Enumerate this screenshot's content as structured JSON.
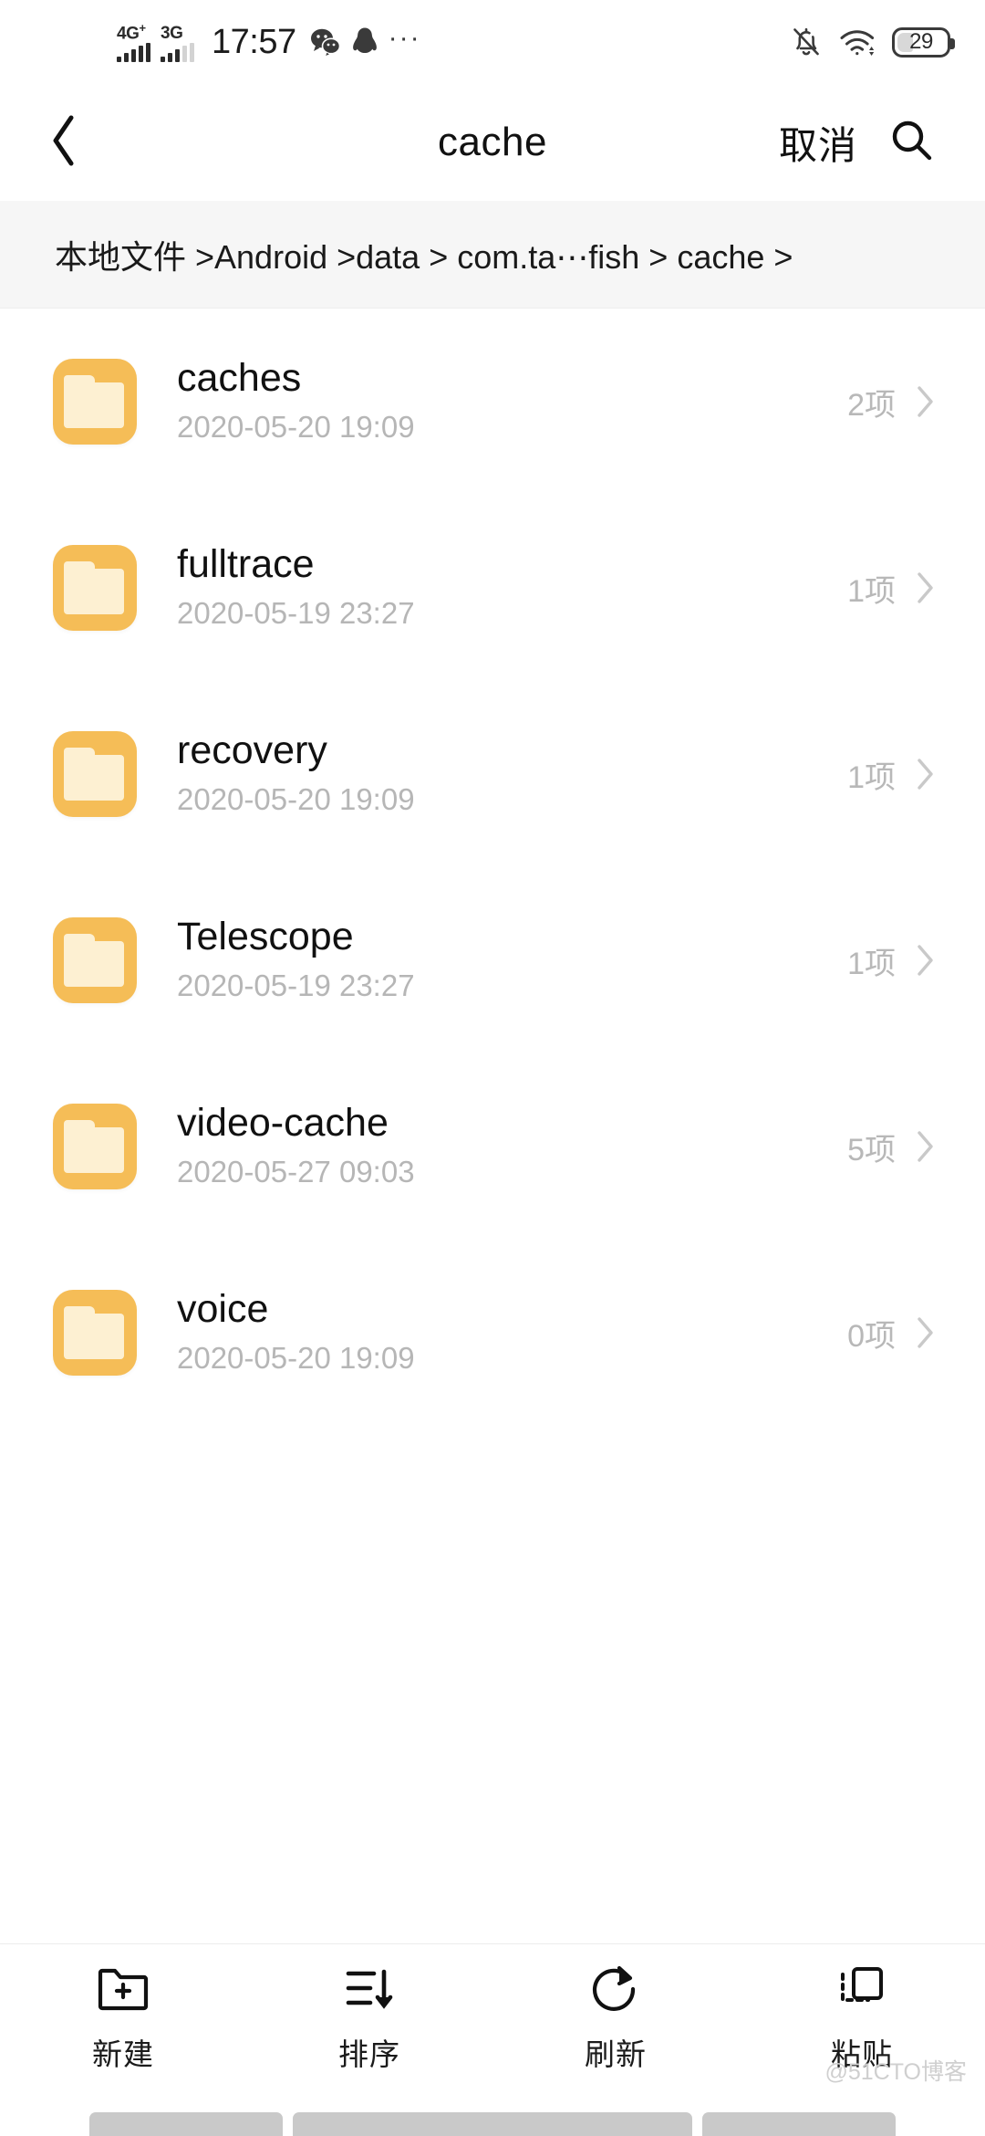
{
  "statusbar": {
    "network_primary": "4G",
    "network_primary_sup": "+",
    "network_secondary": "3G",
    "time": "17:57",
    "icons": [
      "wechat-icon",
      "qq-icon",
      "more-dots-icon",
      "bell-muted-icon",
      "wifi-icon"
    ],
    "battery_percent": "29"
  },
  "header": {
    "back": "back-chevron",
    "title": "cache",
    "cancel_label": "取消",
    "search": "search-icon"
  },
  "breadcrumb": {
    "text": "本地文件 >Android >data > com.ta⋯fish > cache >"
  },
  "list": {
    "items": [
      {
        "name": "caches",
        "date": "2020-05-20 19:09",
        "count": "2项"
      },
      {
        "name": "fulltrace",
        "date": "2020-05-19 23:27",
        "count": "1项"
      },
      {
        "name": "recovery",
        "date": "2020-05-20 19:09",
        "count": "1项"
      },
      {
        "name": "Telescope",
        "date": "2020-05-19 23:27",
        "count": "1项"
      },
      {
        "name": "video-cache",
        "date": "2020-05-27 09:03",
        "count": "5项"
      },
      {
        "name": "voice",
        "date": "2020-05-20 19:09",
        "count": "0项"
      }
    ]
  },
  "toolbar": {
    "items": [
      {
        "label": "新建",
        "icon": "folder-plus-icon"
      },
      {
        "label": "排序",
        "icon": "sort-descending-icon"
      },
      {
        "label": "刷新",
        "icon": "refresh-icon"
      },
      {
        "label": "粘贴",
        "icon": "paste-icon"
      }
    ]
  },
  "watermark": {
    "text": "@51CTO博客"
  },
  "colors": {
    "folder_accent": "#f5bd57",
    "folder_sheet": "#fdf0d2",
    "breadcrumb_bg": "#f6f6f6",
    "secondary_text": "#b6b6b6"
  }
}
